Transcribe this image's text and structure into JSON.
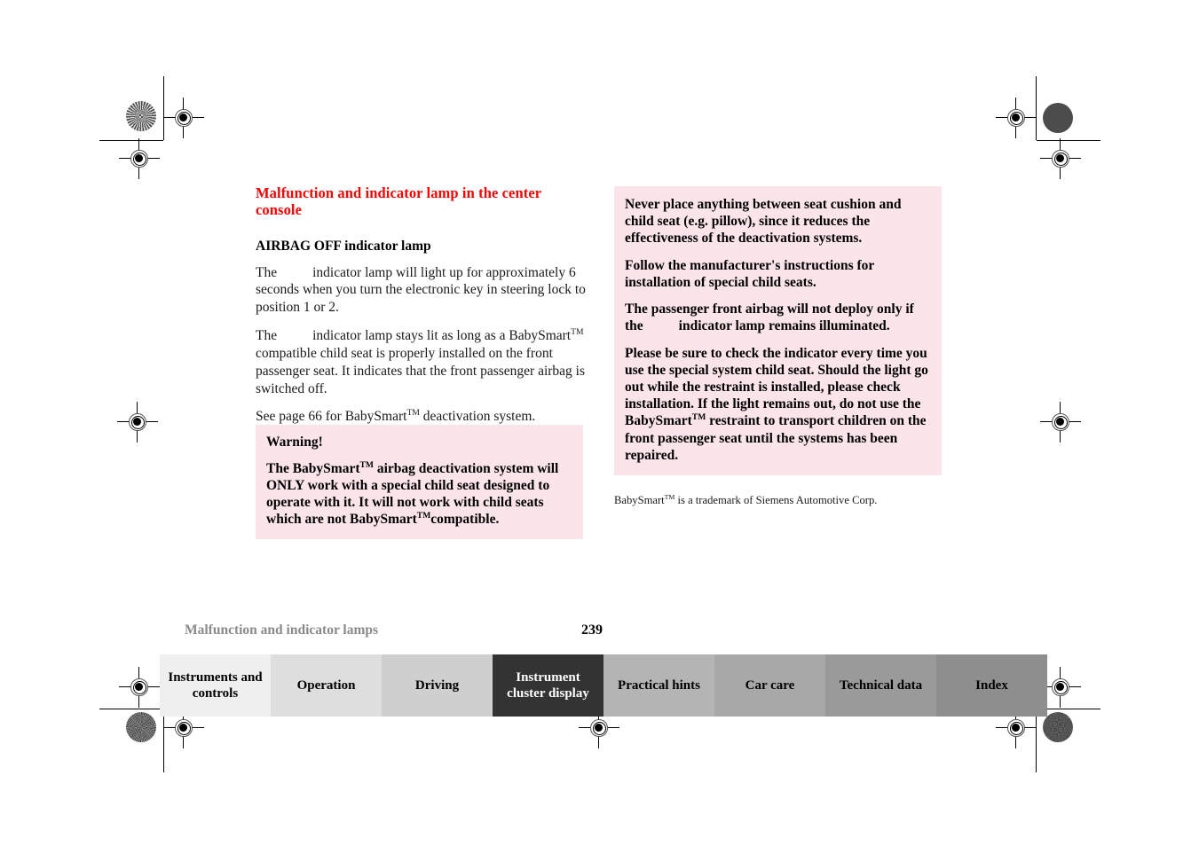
{
  "document": {
    "page_number": "239",
    "running_footer": "Malfunction and indicator lamps"
  },
  "left_column": {
    "section_title": "Malfunction and indicator lamp in the center console",
    "sub_title": "AIRBAG OFF indicator lamp",
    "paragraphs": [
      {
        "prefix": "The",
        "rest": "indicator lamp will light up for approximately 6 seconds when you turn the electronic key in steering lock to position 1 or 2."
      },
      {
        "prefix": "The",
        "part1": "indicator lamp stays lit as long as a BabySmart",
        "tm1": "TM",
        "part2": " compatible child seat is properly installed on the front passenger seat. It indicates that the front passenger airbag is switched off."
      },
      {
        "part1": "See page 66 for BabySmart",
        "tm1": "TM",
        "part2": " deactivation system."
      }
    ]
  },
  "warning_box_left": {
    "title": "Warning!",
    "part1": "The BabySmart",
    "tm1": "TM",
    "part2": " airbag deactivation system will ONLY work with a special child seat designed to operate with it. It will not work with child seats which are not BabySmart",
    "tm2": "TM",
    "part3": "compatible."
  },
  "warning_box_right": {
    "para1": "Never place anything between seat cushion and child seat (e.g. pillow), since it reduces the effectiveness of the deactivation systems.",
    "para2": "Follow the manufacturer's instructions for installation of special child seats.",
    "para3_line1": "The passenger front airbag will not deploy only if",
    "para3_prefix": "the",
    "para3_rest": "indicator lamp remains illuminated.",
    "para4_part1": "Please be sure to check the indicator every time you use the special system child seat. Should the light go out while the restraint is installed, please check installation. If the light remains out, do not use the BabySmart",
    "para4_tm": "TM",
    "para4_part2": " restraint to transport children on the front passenger seat until the systems has been repaired."
  },
  "footnote": {
    "part1": "BabySmart",
    "tm": "TM",
    "part2": " is a trademark of Siemens Automotive Corp."
  },
  "tabs": [
    {
      "label": "Instruments and controls",
      "active": false,
      "bg": "#efefef"
    },
    {
      "label": "Operation",
      "active": false,
      "bg": "#dedede"
    },
    {
      "label": "Driving",
      "active": false,
      "bg": "#cfcfcf"
    },
    {
      "label": "Instrument cluster display",
      "active": true,
      "bg": "#333333"
    },
    {
      "label": "Practical hints",
      "active": false,
      "bg": "#b4b4b4"
    },
    {
      "label": "Car care",
      "active": false,
      "bg": "#a8a8a8"
    },
    {
      "label": "Technical data",
      "active": false,
      "bg": "#9a9a9a"
    },
    {
      "label": "Index",
      "active": false,
      "bg": "#8e8e8e"
    }
  ],
  "colors": {
    "heading_red": "#ff0000",
    "warning_pink": "#fbe4ea",
    "footer_gray": "#8a8a8a",
    "active_tab": "#333333"
  }
}
